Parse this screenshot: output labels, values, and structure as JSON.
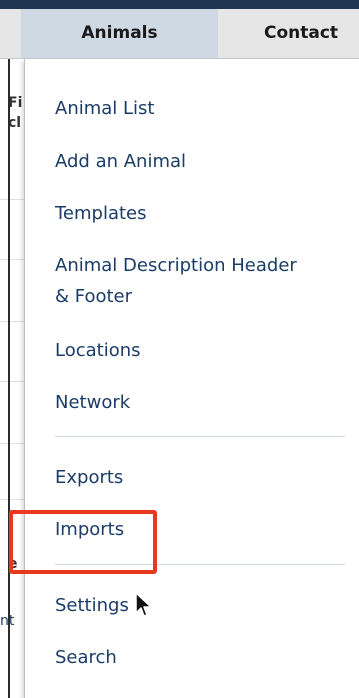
{
  "nav": {
    "tabs": [
      {
        "label": "Animals"
      },
      {
        "label": "Contact"
      }
    ]
  },
  "background": {
    "fragments": [
      "Fi",
      "cl",
      "e",
      "nt"
    ]
  },
  "menu": {
    "items": [
      {
        "label": "Animal List"
      },
      {
        "label": "Add an Animal"
      },
      {
        "label": "Templates"
      },
      {
        "label": "Animal Description Header"
      },
      {
        "label": "& Footer"
      },
      {
        "label": "Locations"
      },
      {
        "label": "Network"
      },
      {
        "label": "Exports"
      },
      {
        "label": "Imports"
      },
      {
        "label": "Settings"
      },
      {
        "label": "Search"
      }
    ]
  },
  "colors": {
    "accent": "#1b3c66",
    "highlight": "#e8391f",
    "tab_active": "#cfd9e3"
  },
  "icons": {
    "cursor": "pointer-cursor-icon"
  }
}
